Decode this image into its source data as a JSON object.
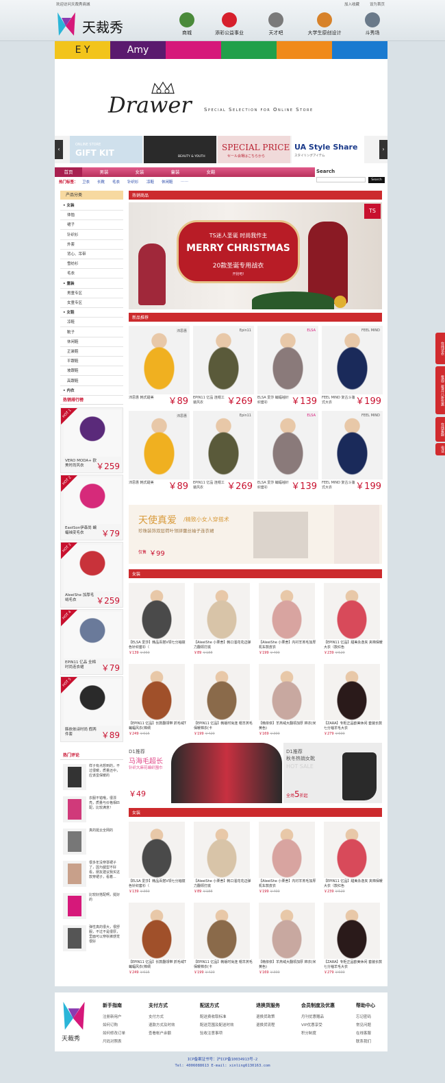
{
  "topbar": {
    "welcome": "欢迎访问天裁秀商城",
    "favorite": "加入收藏",
    "homepage": "设为首页"
  },
  "logo": {
    "text": "天裁秀"
  },
  "nav": [
    {
      "label": "商城",
      "icon": "store-icon",
      "color": "#4a8a3a"
    },
    {
      "label": "添彩公益事业",
      "icon": "heart-icon",
      "color": "#d61f2c"
    },
    {
      "label": "天才吧",
      "icon": "house-icon",
      "color": "#7a7a7a"
    },
    {
      "label": "大学生原创设计",
      "icon": "compass-icon",
      "color": "#d7822a"
    },
    {
      "label": "斗秀场",
      "icon": "stadium-icon",
      "color": "#6a7a8a"
    }
  ],
  "colorbar": [
    {
      "label": "E Y",
      "color": "#f2c41b"
    },
    {
      "label": "Amy",
      "color": "#5a1a6e"
    },
    {
      "label": "",
      "color": "#d6187a"
    },
    {
      "label": "",
      "color": "#21a04a"
    },
    {
      "label": "",
      "color": "#f08a1a"
    },
    {
      "label": "",
      "color": "#1a7ad0"
    }
  ],
  "banner": {
    "brand": "Drawer",
    "tagline": "Special Selection for Online Store"
  },
  "brandstrip": [
    "GIFT KIT",
    "BEAUTY & YOUTH",
    "SPECIAL PRICE",
    "UA Style Share"
  ],
  "brandstrip_sub": [
    "ONLINE STORE",
    "UNITED ARROWS",
    "セール会場はこちらから",
    "スタイリングアイテム"
  ],
  "mainnav": {
    "items": [
      "首页",
      "男装",
      "女装",
      "童装",
      "女鞋"
    ],
    "search_title": "Search",
    "search_button": "Search",
    "search_placeholder": ""
  },
  "hottags": {
    "label": "热门标签：",
    "tags": [
      "卫衣",
      "长靴",
      "毛衣",
      "针织衫",
      "凉鞋",
      "休闲鞋",
      "……"
    ]
  },
  "sidebar": {
    "title": "产品分类",
    "categories": [
      {
        "label": "女装",
        "head": true
      },
      {
        "label": "体恤",
        "head": false
      },
      {
        "label": "裙子",
        "head": false
      },
      {
        "label": "针织衫",
        "head": false
      },
      {
        "label": "外套",
        "head": false
      },
      {
        "label": "背心、吊带",
        "head": false
      },
      {
        "label": "雪纺衫",
        "head": false
      },
      {
        "label": "毛衣",
        "head": false
      },
      {
        "label": "童装",
        "head": true
      },
      {
        "label": "男童专区",
        "head": false
      },
      {
        "label": "女童专区",
        "head": false
      },
      {
        "label": "女鞋",
        "head": true
      },
      {
        "label": "凉鞋",
        "head": false
      },
      {
        "label": "靴子",
        "head": false
      },
      {
        "label": "休闲鞋",
        "head": false
      },
      {
        "label": "正装鞋",
        "head": false
      },
      {
        "label": "平跟鞋",
        "head": false
      },
      {
        "label": "坡跟鞋",
        "head": false
      },
      {
        "label": "高跟鞋",
        "head": false
      },
      {
        "label": "内衣",
        "head": true
      }
    ],
    "rank_title": "热销排行榜",
    "rank": [
      {
        "badge": "HOT 1",
        "name": "VERO MODA+ 欧美时尚风衣",
        "price": "￥259",
        "color": "#5a2a7a"
      },
      {
        "badge": "HOT 2",
        "name": "EastSon伊森尚 蝙蝠袖变毛衣",
        "price": "￥79",
        "color": "#d62a7a"
      },
      {
        "badge": "HOT 3",
        "name": "AleeiShe 加厚毛绒毛衣",
        "price": "￥259",
        "color": "#c8323a"
      },
      {
        "badge": "HOT 4",
        "name": "EPIN11 亿品 全棉时尚连衣裙",
        "price": "￥79",
        "color": "#6a7a9a"
      },
      {
        "badge": "HOT 5",
        "name": "韩依依诗时尚 假两件套",
        "price": "￥89",
        "color": "#2a2a2a"
      }
    ],
    "comment_title": "热门评论",
    "comments": [
      {
        "text": "样子有点想到的，不过很暖，质量还中，应该蛮保暖的",
        "color": "#333"
      },
      {
        "text": "衣服不错哦，很漂亮，质量与价格相匹配，比较满意！",
        "color": "#d03a7a"
      },
      {
        "text": "真的挺云全网的",
        "color": "#777"
      },
      {
        "text": "很多年没穿罩裙子了，因为腿型不好看，朋友建议我买这款穿裙子，看着...",
        "color": "#c8a08a"
      },
      {
        "text": "比较好搭配啊，挺好的",
        "color": "#d6187a"
      },
      {
        "text": "弹性真的很大，很舒服，不过不是很厚，里面可以穿秋裤感觉很好",
        "color": "#555"
      }
    ]
  },
  "sections": {
    "hot": "热销商品",
    "new": "新品推荐",
    "women": "女装",
    "women2": "女装"
  },
  "christmas": {
    "top": "TS迷人圣诞 时尚我作主",
    "title": "MERRY CHRISTMAS",
    "sub": "20款圣诞专用战衣",
    "small": "开抢吧!",
    "badge": "TS"
  },
  "newproducts": [
    {
      "brand": "沛思惠 韩式甜美",
      "price": "￥89",
      "logo": "沛思惠",
      "color": "#f0b020"
    },
    {
      "brand": "EPIN11 亿品 连帽工装风衣",
      "price": "￥269",
      "logo": "Epin11",
      "color": "#5a5a3a"
    },
    {
      "brand": "ELSA 爱莎 蝙蝠袖针织套衫",
      "price": "￥139",
      "logo": "ELSA",
      "color": "#8a7a7a"
    },
    {
      "brand": "FEEL MIND 复古斗篷式大衣",
      "price": "￥199",
      "logo": "FEEL MIND",
      "color": "#1a2a5a"
    },
    {
      "brand": "沛思惠 韩式甜美",
      "price": "￥89",
      "logo": "沛思惠",
      "color": "#f0b020"
    },
    {
      "brand": "EPIN11 亿品 连帽工装风衣",
      "price": "￥269",
      "logo": "Epin11",
      "color": "#5a5a3a"
    },
    {
      "brand": "ELSA 爱莎 蝙蝠袖针织套衫",
      "price": "￥139",
      "logo": "ELSA",
      "color": "#8a7a7a"
    },
    {
      "brand": "FEEL MIND 复古斗篷式大衣",
      "price": "￥199",
      "logo": "FEEL MIND",
      "color": "#1a2a5a"
    }
  ],
  "angel": {
    "title": "天使真爱",
    "title2": "/精致小女人穿搭术",
    "sub": "珍珠装饰双层荷叶领拼蕾丝袖子连衣裙",
    "price_label": "仅售",
    "price": "￥99"
  },
  "women_products": [
    {
      "name": "【ELSA 爱莎】韩品百搭V领七分袖撞色针织套衫（",
      "price": "￥139",
      "old": "￥369",
      "color": "#4a4a4a"
    },
    {
      "name": "【AleeiShe 小栗舍】韩口溜花花边弹力翻领打底",
      "price": "￥89",
      "old": "￥188",
      "color": "#d8c4a8"
    },
    {
      "name": "【AleeiShe 小栗舍】内衬羊羔毛加厚机车款皮衣",
      "price": "￥199",
      "old": "￥499",
      "color": "#d8a4a0"
    },
    {
      "name": "【EPIN11 亿品】甜美永逸夹 夹棉保暖大衣（款红色",
      "price": "￥239",
      "old": "￥529",
      "color": "#d84a5a"
    },
    {
      "name": "【EPIN11 亿品】长款翻领带 抓毛绒T 蝙蝠风衣(棉绸",
      "price": "￥249",
      "old": "￥615",
      "color": "#a0502a"
    },
    {
      "name": "【EPIN11 亿品】韩版时尚连 帽羊羔毛保暖棉衣(卡",
      "price": "￥199",
      "old": "￥429",
      "color": "#8a6a4a"
    },
    {
      "name": "【韩依依】羊羔绒大翻领加厚 棉衣(米黄色)",
      "price": "￥169",
      "old": "￥399",
      "color": "#c8a8a0"
    },
    {
      "name": "【ZARA】专柜正品欧美休闲 套装长款七分袖羊毛大衣",
      "price": "￥279",
      "old": "￥699",
      "color": "#2a1a1a"
    }
  ],
  "d1": {
    "left_title": "D1推荐",
    "left_sub": "马海毛超长",
    "left_small": "针织大麻花编织围巾",
    "left_price": "￥49",
    "right_title": "D1推荐",
    "right_sub": "秋冬热销女靴",
    "right_hot": "HOT SALE",
    "right_sale": "全场",
    "right_discount": "5",
    "right_off": "折起"
  },
  "footer": {
    "logo": "天裁秀",
    "cols": [
      {
        "title": "新手指南",
        "items": [
          "注册新用户",
          "如何订购",
          "如何修改订单",
          "尺码对照表"
        ]
      },
      {
        "title": "支付方式",
        "items": [
          "支付方式",
          "退款方式及时效",
          "查看帐户余额"
        ]
      },
      {
        "title": "配送方式",
        "items": [
          "配送费收取标准",
          "配送范围及配送时效",
          "验收注意事项"
        ]
      },
      {
        "title": "退换货服务",
        "items": [
          "退换货政策",
          "退换货流程"
        ]
      },
      {
        "title": "会员制度及优惠",
        "items": [
          "月刊优惠赠品",
          "VIP优惠享受",
          "积分制度"
        ]
      },
      {
        "title": "帮助中心",
        "items": [
          "忘记密码",
          "常见问题",
          "在线客服",
          "联系我们"
        ]
      }
    ],
    "icp": "ICP备案证书号：沪ICP备10034913号-2",
    "contact": "Tel: 4006088613     E-mail: xinling6130163.com"
  },
  "sidetabs": [
    "在线试衣",
    "每周二每月八折优惠",
    "在线客服",
    "电话"
  ]
}
